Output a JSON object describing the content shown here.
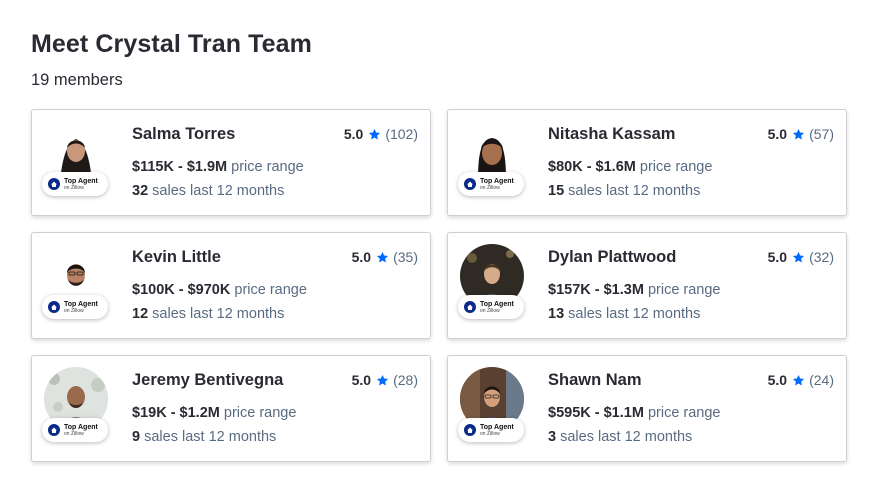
{
  "team": {
    "title": "Meet Crystal Tran Team",
    "member_count": "19 members"
  },
  "badge": {
    "line1": "Top Agent",
    "line2": "on Zillow"
  },
  "labels": {
    "price_suffix": "price range",
    "sales_suffix": "sales last 12 months"
  },
  "colors": {
    "star": "#006aff",
    "text_dark": "#2a2a33",
    "text_muted": "#596b82",
    "badge_blue": "#0a2a8a"
  },
  "agents": [
    {
      "name": "Salma Torres",
      "rating": "5.0",
      "reviews": "(102)",
      "price_range": "$115K - $1.9M",
      "sales": "32",
      "avatar_icon": "agent-photo-icon"
    },
    {
      "name": "Nitasha Kassam",
      "rating": "5.0",
      "reviews": "(57)",
      "price_range": "$80K - $1.6M",
      "sales": "15",
      "avatar_icon": "agent-photo-icon"
    },
    {
      "name": "Kevin Little",
      "rating": "5.0",
      "reviews": "(35)",
      "price_range": "$100K - $970K",
      "sales": "12",
      "avatar_icon": "agent-photo-icon"
    },
    {
      "name": "Dylan Plattwood",
      "rating": "5.0",
      "reviews": "(32)",
      "price_range": "$157K - $1.3M",
      "sales": "13",
      "avatar_icon": "agent-photo-icon"
    },
    {
      "name": "Jeremy Bentivegna",
      "rating": "5.0",
      "reviews": "(28)",
      "price_range": "$19K - $1.2M",
      "sales": "9",
      "avatar_icon": "agent-photo-icon"
    },
    {
      "name": "Shawn Nam",
      "rating": "5.0",
      "reviews": "(24)",
      "price_range": "$595K - $1.1M",
      "sales": "3",
      "avatar_icon": "agent-photo-icon"
    }
  ]
}
